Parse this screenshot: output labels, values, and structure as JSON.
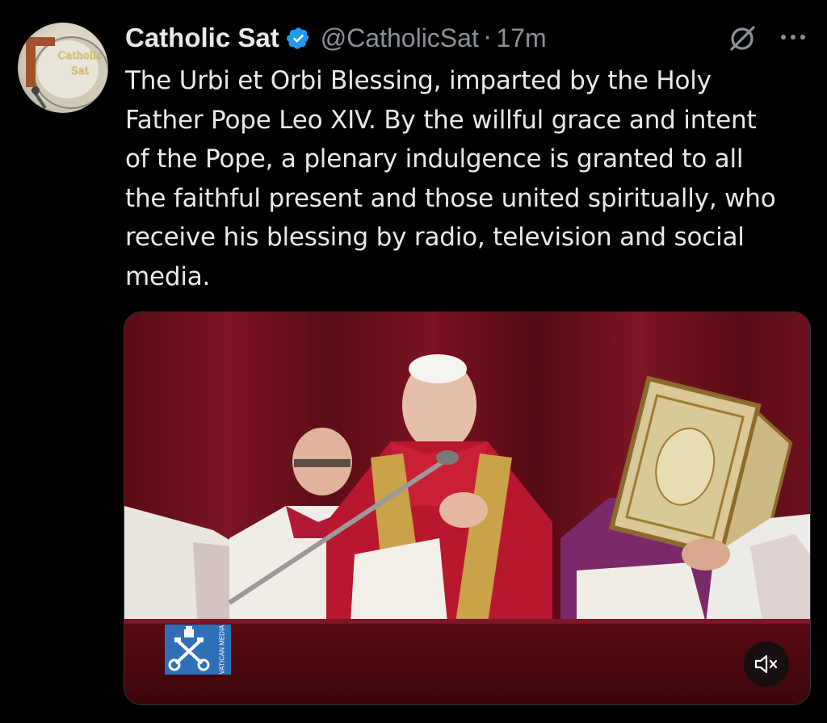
{
  "author": {
    "display_name": "Catholic Sat",
    "handle": "@CatholicSat",
    "separator": "·",
    "timestamp": "17m",
    "verified": true,
    "avatar_text_line1": "Catholic",
    "avatar_text_line2": "Sat"
  },
  "tweet": {
    "text": "The Urbi et Orbi Blessing, imparted by the Holy Father Pope Leo XIV. By the willful grace and intent of the Pope, a plenary indulgence is granted to all the faithful present and those united spiritually, who receive his blessing by radio, television and social media."
  },
  "media": {
    "type": "video",
    "watermark_text": "VATICAN MEDIA",
    "muted": true
  },
  "icons": {
    "verified": "verified-badge-icon",
    "grok": "grok-icon",
    "more": "more-options-icon",
    "mute": "muted-speaker-icon"
  },
  "colors": {
    "background": "#000000",
    "text_primary": "#e7e9ea",
    "text_secondary": "#8b9197",
    "verified_blue": "#1d9bf0",
    "watermark_blue": "#2f6fb8"
  }
}
